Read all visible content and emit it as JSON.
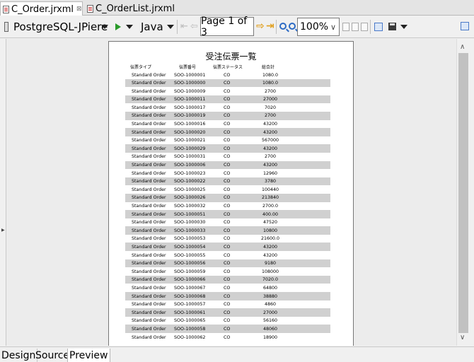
{
  "tabs": [
    {
      "label": "C_Order.jrxml",
      "close": "⊠"
    },
    {
      "label": "C_OrderList.jrxml"
    }
  ],
  "toolbar": {
    "datasource": "PostgreSQL-JPiere",
    "language": "Java",
    "page_indicator": "Page 1 of 3",
    "zoom": "100%"
  },
  "report": {
    "title": "受注伝票一覧",
    "columns": [
      "伝票タイプ",
      "伝票番号",
      "伝票ステータス",
      "総合計"
    ],
    "rows": [
      [
        "Standard Order",
        "SOO-1000001",
        "CO",
        "1080.0"
      ],
      [
        "Standard Order",
        "SOO-1000000",
        "CO",
        "1080.0"
      ],
      [
        "Standard Order",
        "SOO-1000009",
        "CO",
        "2700"
      ],
      [
        "Standard Order",
        "SOO-1000011",
        "CO",
        "27000"
      ],
      [
        "Standard Order",
        "SOO-1000017",
        "CO",
        "7020"
      ],
      [
        "Standard Order",
        "SOO-1000019",
        "CO",
        "2700"
      ],
      [
        "Standard Order",
        "SOO-1000016",
        "CO",
        "43200"
      ],
      [
        "Standard Order",
        "SOO-1000020",
        "CO",
        "43200"
      ],
      [
        "Standard Order",
        "SOO-1000021",
        "CO",
        "567000"
      ],
      [
        "Standard Order",
        "SOO-1000029",
        "CO",
        "43200"
      ],
      [
        "Standard Order",
        "SOO-1000031",
        "CO",
        "2700"
      ],
      [
        "Standard Order",
        "SOO-1000006",
        "CO",
        "43200"
      ],
      [
        "Standard Order",
        "SOO-1000023",
        "CO",
        "12960"
      ],
      [
        "Standard Order",
        "SOO-1000022",
        "CO",
        "3780"
      ],
      [
        "Standard Order",
        "SOO-1000025",
        "CO",
        "100440"
      ],
      [
        "Standard Order",
        "SOO-1000026",
        "CO",
        "213840"
      ],
      [
        "Standard Order",
        "SOO-1000032",
        "CO",
        "2700.0"
      ],
      [
        "Standard Order",
        "SOO-1000051",
        "CO",
        "400.00"
      ],
      [
        "Standard Order",
        "SOO-1000030",
        "CO",
        "47520"
      ],
      [
        "Standard Order",
        "SOO-1000033",
        "CO",
        "10800"
      ],
      [
        "Standard Order",
        "SOO-1000053",
        "CO",
        "21600.0"
      ],
      [
        "Standard Order",
        "SOO-1000054",
        "CO",
        "43200"
      ],
      [
        "Standard Order",
        "SOO-1000055",
        "CO",
        "43200"
      ],
      [
        "Standard Order",
        "SOO-1000056",
        "CO",
        "9180"
      ],
      [
        "Standard Order",
        "SOO-1000059",
        "CO",
        "108000"
      ],
      [
        "Standard Order",
        "SOO-1000066",
        "CO",
        "7020.0"
      ],
      [
        "Standard Order",
        "SOO-1000067",
        "CO",
        "64800"
      ],
      [
        "Standard Order",
        "SOO-1000068",
        "CO",
        "38880"
      ],
      [
        "Standard Order",
        "SOO-1000057",
        "CO",
        "4860"
      ],
      [
        "Standard Order",
        "SOO-1000061",
        "CO",
        "27000"
      ],
      [
        "Standard Order",
        "SOO-1000065",
        "CO",
        "56160"
      ],
      [
        "Standard Order",
        "SOO-1000058",
        "CO",
        "48060"
      ],
      [
        "Standard Order",
        "SOO-1000062",
        "CO",
        "18900"
      ]
    ]
  },
  "bottom_tabs": [
    "Design",
    "Source",
    "Preview"
  ],
  "colors": {
    "shade": "#d0d0d0",
    "run": "#2a9a2a",
    "zoom_icon": "#2d6bc4",
    "nav_arrow": "#e0a020"
  }
}
